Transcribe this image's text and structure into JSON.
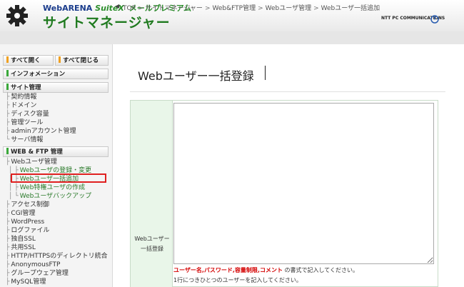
{
  "header": {
    "brand": "WebARENA",
    "brand_suite": "SuiteX",
    "premium": "メールプレミアム",
    "site_title": "サイトマネージャー",
    "ntt": "NTT PC COMMUNICATIONS"
  },
  "breadcrumb": {
    "items": [
      "TOP",
      "サイトマネージャー",
      "Web&FTP管理",
      "Webユーザ管理",
      "Webユーザ一括追加"
    ]
  },
  "sidebar": {
    "open_all": "すべて開く",
    "close_all": "すべて閉じる",
    "information": "インフォメーション",
    "site_management": "サイト管理",
    "site_items": [
      "契約情報",
      "ドメイン",
      "ディスク容量",
      "管理ツール",
      "adminアカウント管理",
      "サーバ情報"
    ],
    "web_ftp": "WEB & FTP 管理",
    "web_user_mgmt": "Webユーザ管理",
    "web_user_sub": [
      "Webユーザの登録・変更",
      "Webユーザ一括追加",
      "Web特権ユーザの作成",
      "Webユーザバックアップ"
    ],
    "other_items": [
      "アクセス制御",
      "CGI管理",
      "WordPress",
      "ログファイル",
      "独自SSL",
      "共用SSL",
      "HTTP/HTTPSのディレクトリ統合",
      "AnonymousFTP",
      "グループウェア管理",
      "MySQL管理"
    ],
    "colors": {
      "bar_orange": "#f0a020",
      "bar_green": "#3aa83a"
    }
  },
  "main": {
    "title": "Webユーザー一括登録",
    "label_line1": "Webユーザー",
    "label_line2": "一括登録",
    "textarea_value": "",
    "note_red_1": "ユーザー名",
    "note_red_2": "パスワード",
    "note_red_3": "容量制限",
    "note_red_4": "コメント",
    "note_sep": ",",
    "note_suffix": " の書式で記入してください。",
    "note_line2": "1行につきひとつのユーザーを記入してください。"
  }
}
